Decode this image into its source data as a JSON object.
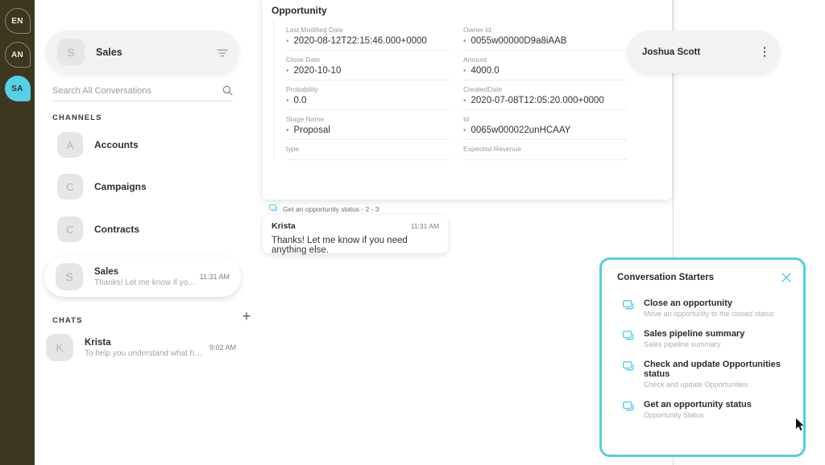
{
  "theme": {
    "rail_bg": "#3d3720",
    "accent_cyan": "#53cde9",
    "avatar_active_bg": "#56cfe8"
  },
  "rail": {
    "avatars": [
      {
        "initials": "EN",
        "style": "outline"
      },
      {
        "initials": "AN",
        "style": "outline"
      },
      {
        "initials": "SA",
        "style": "filled"
      }
    ]
  },
  "sidebar": {
    "header": {
      "avatar_letter": "S",
      "title": "Sales",
      "filter_icon": "funnel-icon"
    },
    "search": {
      "placeholder": "Search All Conversations",
      "value": "",
      "icon": "search-icon"
    },
    "channels_label": "CHANNELS",
    "channels": [
      {
        "avatar_letter": "A",
        "name": "Accounts"
      },
      {
        "avatar_letter": "C",
        "name": "Campaigns"
      },
      {
        "avatar_letter": "C",
        "name": "Contracts"
      }
    ],
    "active_conversation": {
      "avatar_letter": "S",
      "title": "Sales",
      "preview": "Thanks! Let me know if you need ...",
      "time": "11:31 AM"
    },
    "chats_label": "CHATS",
    "add_chat_icon": "plus-icon",
    "chats": [
      {
        "avatar_letter": "K",
        "title": "Krista",
        "preview": "To help you understand what happ...",
        "time": "9:02 AM"
      }
    ]
  },
  "opportunity": {
    "title": "Opportunity",
    "left_fields": [
      {
        "label": "Last Modified Date",
        "value": "2020-08-12T22:15:46.000+0000"
      },
      {
        "label": "Close Date",
        "value": "2020-10-10"
      },
      {
        "label": "Probability",
        "value": "0.0"
      },
      {
        "label": "Stage Name",
        "value": "Proposal"
      },
      {
        "label": "type",
        "value": ""
      }
    ],
    "right_fields": [
      {
        "label": "Owner Id",
        "value": "0055w00000D9a8iAAB"
      },
      {
        "label": "Amount",
        "value": "4000.0"
      },
      {
        "label": "CreatedDate",
        "value": "2020-07-08T12:05:20.000+0000"
      },
      {
        "label": "Id",
        "value": "0065w000022unHCAAY"
      },
      {
        "label": "Expected Revenue",
        "value": ""
      }
    ]
  },
  "message": {
    "meta_icon": "chat-bubbles-icon",
    "meta_text": "Get an opportunity status - 2 - 3",
    "author": "Krista",
    "time": "11:31 AM",
    "text": "Thanks! Let me know if you need anything else."
  },
  "person_card": {
    "name": "Joshua Scott",
    "menu_icon": "kebab-menu-icon"
  },
  "conversation_starters": {
    "title": "Conversation Starters",
    "close_icon": "close-icon",
    "items": [
      {
        "icon": "chat-bubbles-icon",
        "title": "Close an opportunity",
        "subtitle": "Move an opportunity to the closed status"
      },
      {
        "icon": "chat-bubbles-icon",
        "title": "Sales pipeline summary",
        "subtitle": "Sales pipeline summary"
      },
      {
        "icon": "chat-bubbles-icon",
        "title": "Check and update Opportunities status",
        "subtitle": "Check and update Opportunities"
      },
      {
        "icon": "chat-bubbles-icon",
        "title": "Get an opportunity status",
        "subtitle": "Opportunity Status"
      }
    ]
  }
}
